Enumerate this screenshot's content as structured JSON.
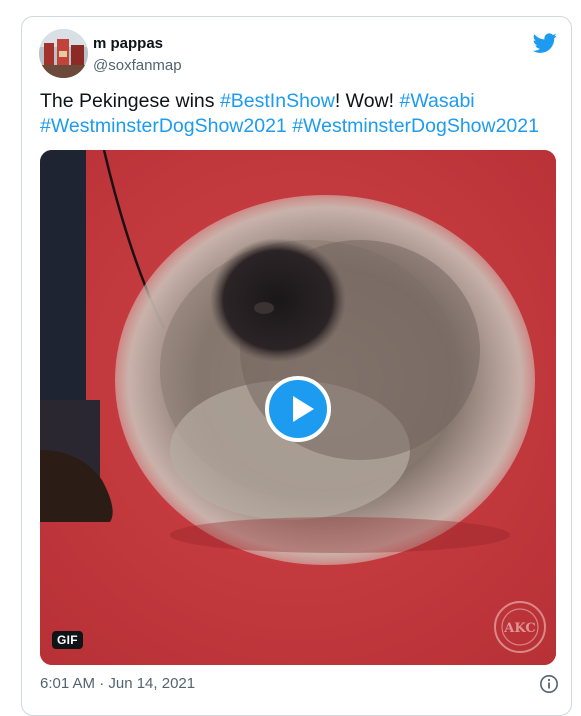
{
  "author": {
    "name": "m pappas",
    "handle": "@soxfanmap"
  },
  "tweet": {
    "text_parts": [
      {
        "type": "text",
        "value": "The Pekingese wins "
      },
      {
        "type": "hashtag",
        "value": "#BestInShow"
      },
      {
        "type": "text",
        "value": "! Wow! "
      },
      {
        "type": "hashtag",
        "value": "#Wasabi"
      },
      {
        "type": "text",
        "value": " "
      },
      {
        "type": "hashtag",
        "value": "#WestminsterDogShow2021"
      },
      {
        "type": "text",
        "value": " "
      },
      {
        "type": "hashtag",
        "value": "#WestminsterDogShow2021"
      }
    ]
  },
  "media": {
    "badge": "GIF",
    "watermark": "AKC"
  },
  "timestamp": "6:01 AM · Jun 14, 2021",
  "icons": {
    "brand": "twitter-bird-icon",
    "play": "play-icon",
    "info": "info-icon"
  },
  "colors": {
    "hashtag": "#1d9bf0",
    "text": "#0f1419",
    "secondary": "#536471",
    "carpet": "#c7373b"
  }
}
